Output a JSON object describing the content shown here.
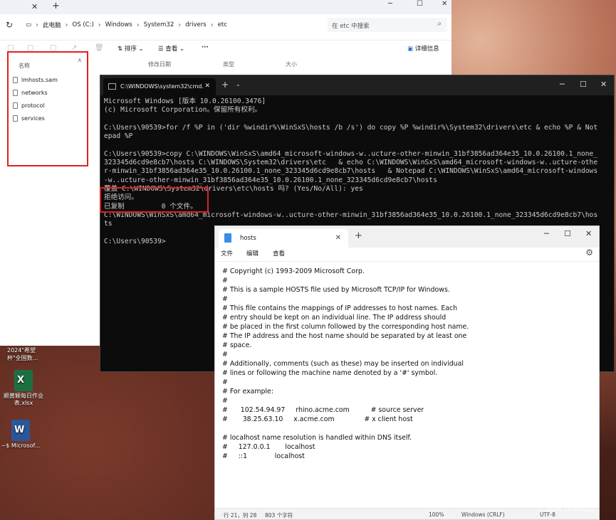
{
  "explorer": {
    "address": [
      "此电脑",
      "OS (C:)",
      "Windows",
      "System32",
      "drivers",
      "etc"
    ],
    "search_placeholder": "在 etc 中搜索",
    "toolbar": {
      "sort": "排序",
      "view": "查看",
      "more": "···",
      "details": "详细信息"
    },
    "columns": {
      "name": "名称",
      "date": "修改日期",
      "type": "类型",
      "size": "大小"
    },
    "files": [
      "lmhosts.sam",
      "networks",
      "protocol",
      "services"
    ]
  },
  "desktop": {
    "strip_text": "2024\"希望杯\"全国数...",
    "icons": [
      {
        "label": "颛黄颖每日作业表.xlsx",
        "glyph": "X"
      },
      {
        "label": "~$ Microsof...",
        "glyph": "W"
      }
    ]
  },
  "cmd": {
    "tab_title": "C:\\WINDOWS\\system32\\cmd.",
    "lines": [
      "Microsoft Windows [版本 10.0.26100.3476]",
      "(c) Microsoft Corporation。保留所有权利。",
      "",
      "C:\\Users\\90539>for /f %P in ('dir %windir%\\WinSxS\\hosts /b /s') do copy %P %windir%\\System32\\drivers\\etc & echo %P & Not",
      "epad %P",
      "",
      "C:\\Users\\90539>copy C:\\WINDOWS\\WinSxS\\amd64_microsoft-windows-w..ucture-other-minwin_31bf3856ad364e35_10.0.26100.1_none_",
      "323345d6cd9e8cb7\\hosts C:\\WINDOWS\\System32\\drivers\\etc   & echo C:\\WINDOWS\\WinSxS\\amd64_microsoft-windows-w..ucture-othe",
      "r-minwin_31bf3856ad364e35_10.0.26100.1_none_323345d6cd9e8cb7\\hosts   & Notepad C:\\WINDOWS\\WinSxS\\amd64_microsoft-windows",
      "-w..ucture-other-minwin_31bf3856ad364e35_10.0.26100.1_none_323345d6cd9e8cb7\\hosts",
      "覆盖 C:\\WINDOWS\\System32\\drivers\\etc\\hosts 吗? (Yes/No/All): yes",
      "拒绝访问。",
      "已复制         0 个文件。",
      "C:\\WINDOWS\\WinSxS\\amd64_microsoft-windows-w..ucture-other-minwin_31bf3856ad364e35_10.0.26100.1_none_323345d6cd9e8cb7\\hos",
      "ts",
      "",
      "C:\\Users\\90539>"
    ]
  },
  "notepad": {
    "tab_title": "hosts",
    "menu": {
      "file": "文件",
      "edit": "编辑",
      "view": "查看"
    },
    "content": "# Copyright (c) 1993-2009 Microsoft Corp.\n#\n# This is a sample HOSTS file used by Microsoft TCP/IP for Windows.\n#\n# This file contains the mappings of IP addresses to host names. Each\n# entry should be kept on an individual line. The IP address should\n# be placed in the first column followed by the corresponding host name.\n# The IP address and the host name should be separated by at least one\n# space.\n#\n# Additionally, comments (such as these) may be inserted on individual\n# lines or following the machine name denoted by a '#' symbol.\n#\n# For example:\n#\n#      102.54.94.97     rhino.acme.com          # source server\n#       38.25.63.10     x.acme.com              # x client host\n\n# localhost name resolution is handled within DNS itself.\n#     127.0.0.1       localhost\n#     ::1             localhost",
    "status": {
      "position": "行 21，列 28",
      "chars": "803 个字符",
      "zoom": "100%",
      "eol": "Windows (CRLF)",
      "encoding": "UTF-8"
    }
  },
  "watermark": "CSDN @Trisyp"
}
